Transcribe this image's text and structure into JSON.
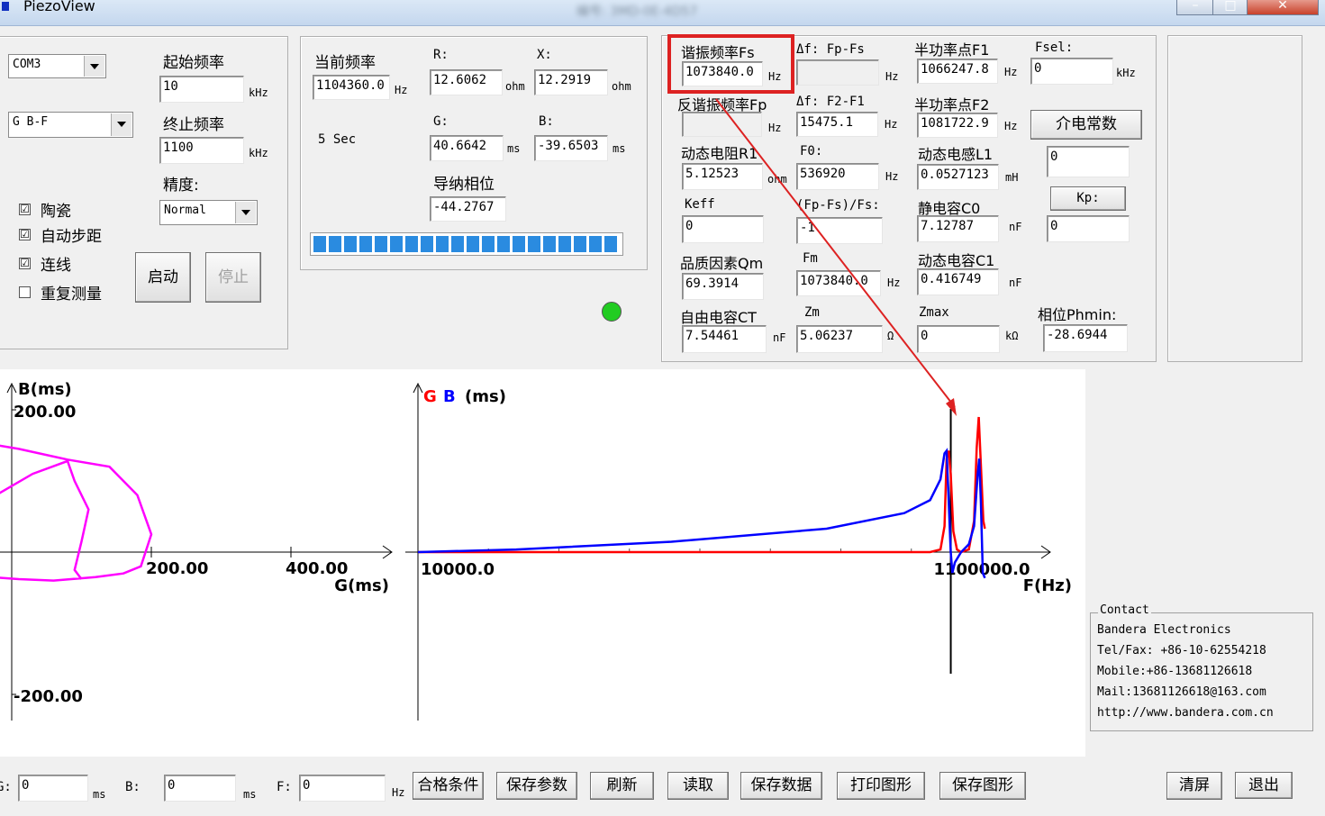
{
  "window": {
    "title": "PiezoView",
    "title_center": "编号: 3MD-0E-4D57"
  },
  "scan": {
    "port": "COM3",
    "mode": "G B-F",
    "start_freq_label": "起始频率",
    "start_freq": "10",
    "stop_freq_label": "终止频率",
    "stop_freq": "1100",
    "unit_khz": "kHz",
    "precision_label": "精度:",
    "precision": "Normal",
    "ceramic_label": "陶瓷",
    "auto_step_label": "自动步距",
    "connect_label": "连线",
    "repeat_label": "重复测量",
    "ceramic_checked": "☑",
    "auto_step_checked": "☑",
    "connect_checked": "☑",
    "repeat_checked": "",
    "start_button": "启动",
    "stop_button": "停止"
  },
  "current": {
    "freq_label": "当前频率",
    "freq": "1104360.0",
    "unit_hz": "Hz",
    "time": "5 Sec",
    "r_label": "R:",
    "r": "12.6062",
    "x_label": "X:",
    "x": "12.2919",
    "ohm": "ohm",
    "g_label": "G:",
    "g": "40.6642",
    "b_label": "B:",
    "b": "-39.6503",
    "ms": "ms",
    "phase_label": "导纳相位",
    "phase": "-44.2767",
    "progress_segments": 20
  },
  "results": {
    "fs_label": "谐振频率Fs",
    "fs": "1073840.0",
    "df_fp_fs_label": "Δf: Fp-Fs",
    "df_fp_fs": "",
    "f1_label": "半功率点F1",
    "f1": "1066247.8",
    "fsel_label": "Fsel:",
    "fsel": "0",
    "fp_label": "反谐振频率Fp",
    "fp": "",
    "df_f2_f1_label": "Δf: F2-F1",
    "df_f2_f1": "15475.1",
    "f2_label": "半功率点F2",
    "f2": "1081722.9",
    "dielectric_button": "介电常数",
    "r1_label": "动态电阻R1",
    "r1": "5.12523",
    "f0_label": "F0:",
    "f0": "536920",
    "l1_label": "动态电感L1",
    "l1": "0.0527123",
    "dielectric_value": "0",
    "keff_label": "Keff",
    "keff": "0",
    "fpfs_ratio_label": "(Fp-Fs)/Fs:",
    "fpfs_ratio": "-1",
    "c0_label": "静电容C0",
    "c0": "7.12787",
    "kp_button": "Kp:",
    "kp_value": "0",
    "qm_label": "品质因素Qm",
    "qm": "69.3914",
    "fm_label": "Fm",
    "fm": "1073840.0",
    "c1_label": "动态电容C1",
    "c1": "0.416749",
    "ct_label": "自由电容CT",
    "ct": "7.54461",
    "zm_label": "Zm",
    "zm": "5.06237",
    "zmax_label": "Zmax",
    "zmax": "0",
    "phmin_label": "相位Phmin:",
    "phmin": "-28.6944",
    "unit_hz": "Hz",
    "unit_ohm": "ohm",
    "unit_mh": "mH",
    "unit_nf": "nF",
    "unit_omega": "Ω",
    "unit_kohm": "kΩ",
    "unit_khz": "kHz"
  },
  "indicator": {
    "color": "#22cc22"
  },
  "chart_data": [
    {
      "type": "line",
      "title": "",
      "ylabel": "B(ms)",
      "xlabel": "G(ms)",
      "y_ticks": [
        "200.00",
        "-200.00"
      ],
      "x_ticks": [
        "200.00",
        "400.00"
      ],
      "xlim": [
        -80,
        520
      ],
      "ylim": [
        -250,
        230
      ],
      "series": [
        {
          "color": "#ff00ff",
          "points": [
            [
              -75,
              10
            ],
            [
              -60,
              90
            ],
            [
              -20,
              150
            ],
            [
              10,
              145
            ],
            [
              80,
              130
            ],
            [
              140,
              120
            ],
            [
              180,
              80
            ],
            [
              200,
              25
            ],
            [
              185,
              -20
            ],
            [
              160,
              -30
            ],
            [
              120,
              -35
            ],
            [
              60,
              -40
            ],
            [
              10,
              -38
            ],
            [
              -30,
              -35
            ],
            [
              -55,
              -10
            ],
            [
              -70,
              30
            ],
            [
              -40,
              70
            ],
            [
              30,
              110
            ],
            [
              80,
              128
            ],
            [
              90,
              100
            ],
            [
              110,
              60
            ],
            [
              100,
              15
            ],
            [
              90,
              -25
            ],
            [
              100,
              -38
            ]
          ]
        }
      ]
    },
    {
      "type": "line",
      "title": "",
      "ylabel_g": "G",
      "ylabel_b": "B",
      "ylabel_unit": "(ms)",
      "xlabel": "F(Hz)",
      "x_ticks": [
        "10000.0",
        "1100000.0"
      ],
      "xlim": [
        10000,
        1150000
      ],
      "ylim": [
        -60,
        280
      ],
      "marker_x": 1040000,
      "series": [
        {
          "name": "G",
          "color": "#ff0000",
          "points": [
            [
              10000,
              0
            ],
            [
              900000,
              0
            ],
            [
              1000000,
              0
            ],
            [
              1020000,
              5
            ],
            [
              1028000,
              50
            ],
            [
              1032000,
              180
            ],
            [
              1036000,
              195
            ],
            [
              1040000,
              150
            ],
            [
              1045000,
              40
            ],
            [
              1052000,
              5
            ],
            [
              1060000,
              0
            ],
            [
              1075000,
              5
            ],
            [
              1085000,
              60
            ],
            [
              1090000,
              200
            ],
            [
              1094000,
              260
            ],
            [
              1098000,
              170
            ],
            [
              1103000,
              60
            ],
            [
              1106000,
              45
            ]
          ]
        },
        {
          "name": "B",
          "color": "#0000ff",
          "points": [
            [
              10000,
              0
            ],
            [
              200000,
              5
            ],
            [
              500000,
              20
            ],
            [
              800000,
              45
            ],
            [
              950000,
              75
            ],
            [
              1000000,
              100
            ],
            [
              1020000,
              140
            ],
            [
              1028000,
              190
            ],
            [
              1032000,
              195
            ],
            [
              1036000,
              100
            ],
            [
              1040000,
              0
            ],
            [
              1043000,
              -40
            ],
            [
              1048000,
              -20
            ],
            [
              1060000,
              0
            ],
            [
              1075000,
              15
            ],
            [
              1085000,
              50
            ],
            [
              1092000,
              150
            ],
            [
              1095000,
              180
            ],
            [
              1098000,
              100
            ],
            [
              1102000,
              -40
            ],
            [
              1106000,
              -50
            ]
          ]
        }
      ]
    }
  ],
  "contact": {
    "legend": "Contact",
    "lines": [
      "Bandera Electronics",
      "Tel/Fax: +86-10-62554218",
      "Mobile:+86-13681126618",
      "Mail:13681126618@163.com",
      "http://www.bandera.com.cn"
    ]
  },
  "bottom": {
    "g_label": "G:",
    "g": "0",
    "b_label": "B:",
    "b": "0",
    "f_label": "F:",
    "f": "0",
    "ms": "ms",
    "hz": "Hz",
    "buttons": {
      "pass_condition": "合格条件",
      "save_params": "保存参数",
      "refresh": "刷新",
      "read": "读取",
      "save_data": "保存数据",
      "print_graph": "打印图形",
      "save_graph": "保存图形",
      "clear_screen": "清屏",
      "exit": "退出"
    }
  },
  "annotation": {
    "color": "#dd2222"
  }
}
